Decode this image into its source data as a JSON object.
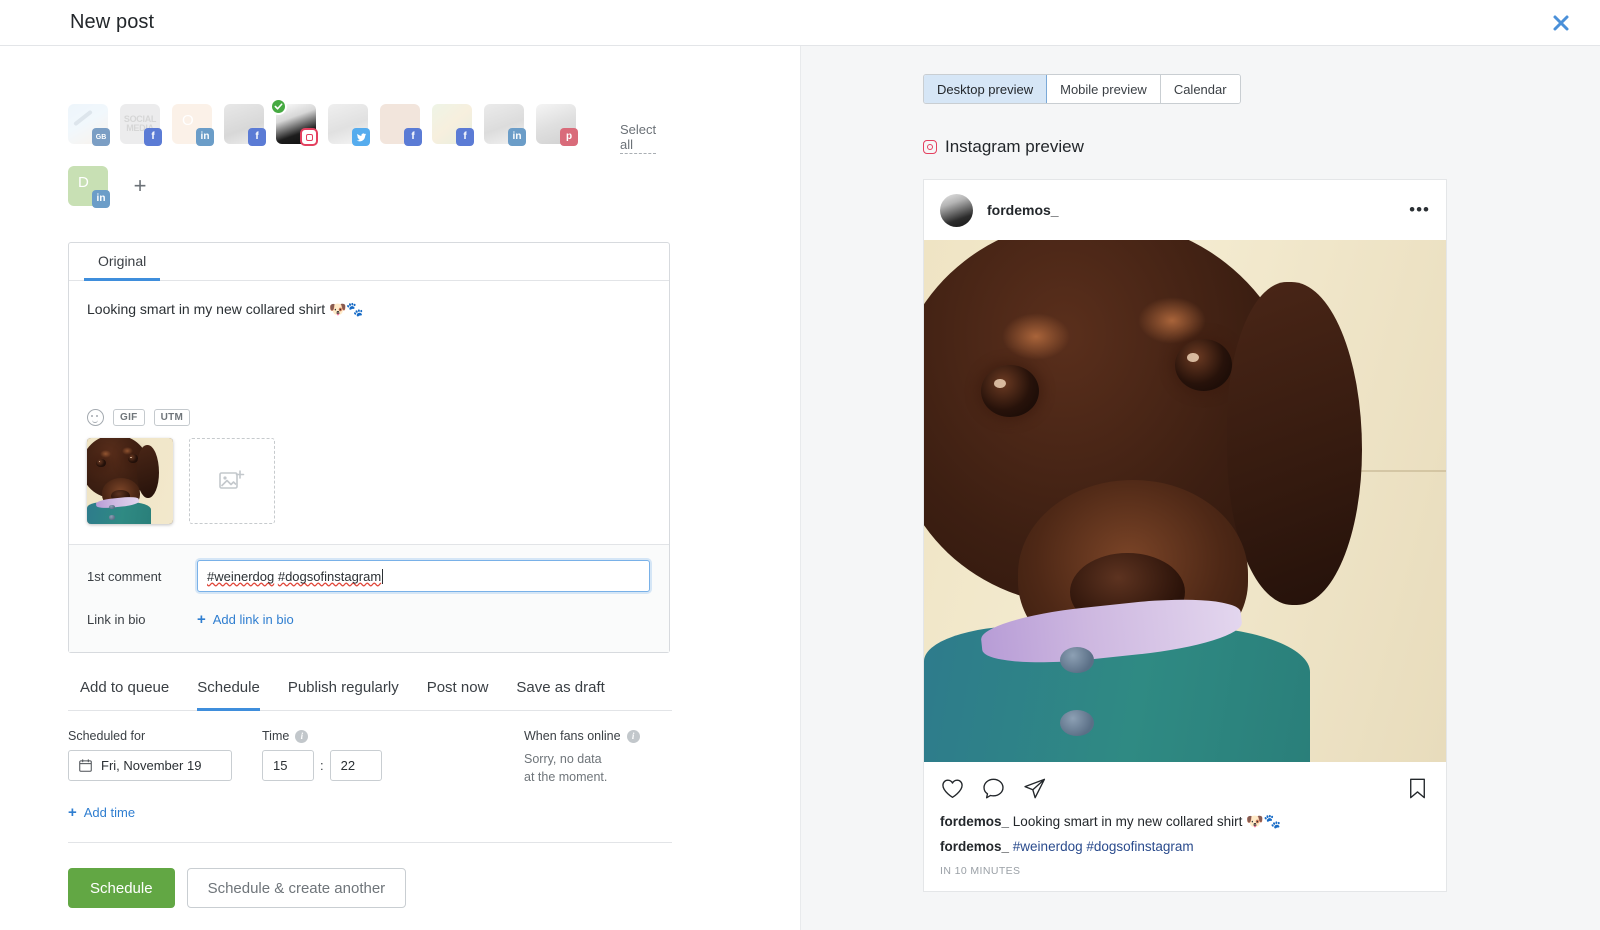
{
  "header": {
    "title": "New post",
    "close_icon": "close-icon"
  },
  "accounts": {
    "select_all_label": "Select all",
    "add_label": "+",
    "items": [
      {
        "platform": "google-business",
        "badge": "GB",
        "selected": false,
        "art": "av-a",
        "initial": ""
      },
      {
        "platform": "facebook",
        "badge": "f",
        "selected": false,
        "art": "av-b",
        "initial": "",
        "text": "SOCIAL MEDIA"
      },
      {
        "platform": "linkedin",
        "badge": "in",
        "selected": false,
        "art": "av-c",
        "initial": "O"
      },
      {
        "platform": "facebook",
        "badge": "f",
        "selected": false,
        "art": "av-d",
        "initial": ""
      },
      {
        "platform": "instagram",
        "badge": "ig",
        "selected": true,
        "art": "av-e",
        "initial": ""
      },
      {
        "platform": "twitter",
        "badge": "t",
        "selected": false,
        "art": "av-f",
        "initial": ""
      },
      {
        "platform": "facebook",
        "badge": "f",
        "selected": false,
        "art": "av-g",
        "initial": ""
      },
      {
        "platform": "facebook",
        "badge": "f",
        "selected": false,
        "art": "av-h",
        "initial": ""
      },
      {
        "platform": "linkedin",
        "badge": "in",
        "selected": false,
        "art": "av-i",
        "initial": ""
      },
      {
        "platform": "pinterest",
        "badge": "p",
        "selected": false,
        "art": "av-j",
        "initial": ""
      },
      {
        "platform": "linkedin",
        "badge": "in",
        "selected": false,
        "art": "av-k",
        "initial": "D"
      }
    ]
  },
  "composer": {
    "tab_label": "Original",
    "post_text": "Looking smart in my new collared shirt ",
    "post_emoji": "🐶🐾",
    "tools": {
      "emoji_icon": "emoji-icon",
      "gif_label": "GIF",
      "utm_label": "UTM"
    },
    "media": {
      "thumb_alt": "dachshund-puppy-photo",
      "add_icon": "add-image-icon"
    },
    "first_comment": {
      "label": "1st comment",
      "value": "#weinerdog #dogsofinstagram",
      "value_part1": "#weinerdog",
      "value_part2": "#dogsofinstagram"
    },
    "link_in_bio": {
      "label": "Link in bio",
      "action_label": "Add link in bio"
    }
  },
  "schedule": {
    "tabs": [
      {
        "label": "Add to queue",
        "active": false
      },
      {
        "label": "Schedule",
        "active": true
      },
      {
        "label": "Publish regularly",
        "active": false
      },
      {
        "label": "Post now",
        "active": false
      },
      {
        "label": "Save as draft",
        "active": false
      }
    ],
    "scheduled_for_label": "Scheduled for",
    "scheduled_for_value": "Fri, November 19",
    "time_label": "Time",
    "time_hour": "15",
    "time_minute": "22",
    "time_separator": ":",
    "fans_label": "When fans online",
    "fans_note_line1": "Sorry, no data",
    "fans_note_line2": "at the moment.",
    "add_time_label": "Add time"
  },
  "footer": {
    "primary_label": "Schedule",
    "secondary_label": "Schedule & create another",
    "primary_color": "#62a744"
  },
  "preview": {
    "toggles": [
      {
        "label": "Desktop preview",
        "active": true
      },
      {
        "label": "Mobile preview",
        "active": false
      },
      {
        "label": "Calendar",
        "active": false
      }
    ],
    "heading": "Instagram preview",
    "card": {
      "username": "fordemos_",
      "menu_icon": "more-options-icon",
      "photo_alt": "dachshund-puppy-in-teal-shirt",
      "actions": {
        "like_icon": "heart-icon",
        "comment_icon": "comment-icon",
        "share_icon": "share-icon",
        "save_icon": "bookmark-icon"
      },
      "caption_user": "fordemos_",
      "caption_text": "Looking smart in my new collared shirt ",
      "caption_emoji": "🐶🐾",
      "comment_user": "fordemos_",
      "comment_tags": "#weinerdog #dogsofinstagram",
      "timestamp": "IN 10 MINUTES"
    }
  }
}
